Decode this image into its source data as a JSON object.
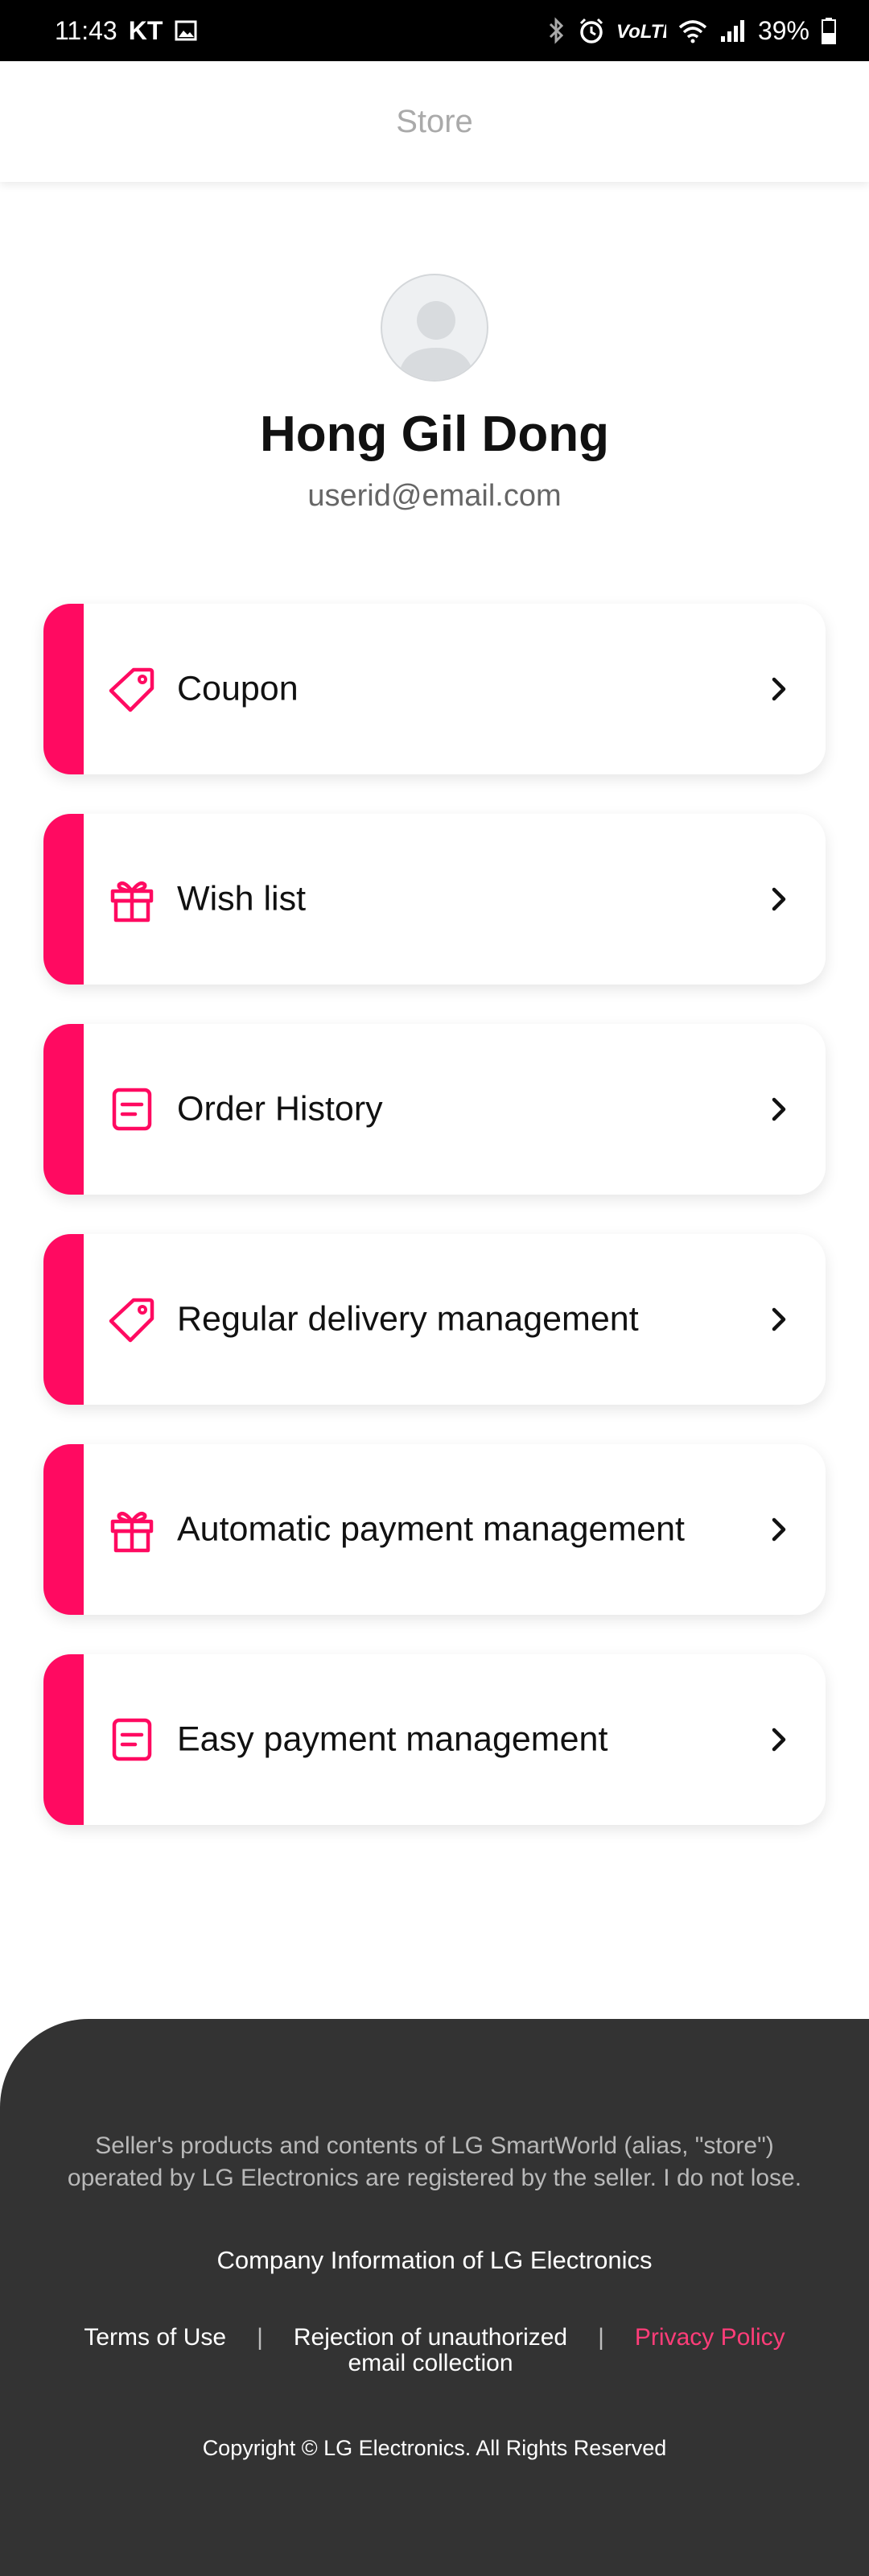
{
  "status_bar": {
    "time": "11:43",
    "carrier": "KT",
    "battery": "39%",
    "icons": [
      "image-icon",
      "bluetooth-icon",
      "alarm-icon",
      "volte-icon",
      "wifi-icon",
      "signal-icon",
      "battery-icon"
    ],
    "volte": "VoLTE"
  },
  "header": {
    "title": "Store"
  },
  "profile": {
    "name": "Hong Gil Dong",
    "email": "userid@email.com"
  },
  "menu": {
    "accent_color": "#ff0a61",
    "items": [
      {
        "label": "Coupon",
        "icon": "tag-icon"
      },
      {
        "label": "Wish list",
        "icon": "gift-icon"
      },
      {
        "label": "Order History",
        "icon": "document-icon"
      },
      {
        "label": "Regular delivery management",
        "icon": "tag-icon"
      },
      {
        "label": "Automatic payment management",
        "icon": "gift-icon"
      },
      {
        "label": "Easy payment management",
        "icon": "document-icon"
      }
    ]
  },
  "footer": {
    "notice_line1": "Seller's products and contents of LG SmartWorld (alias, \"store\")",
    "notice_line2": "operated by LG Electronics are registered by the seller. I do not lose.",
    "company_info": "Company Information of LG Electronics",
    "terms": "Terms of Use",
    "rejection_line1": "Rejection of unauthorized",
    "rejection_line2": "email collection",
    "separator": "|",
    "privacy": "Privacy Policy",
    "privacy_color": "#ff3d79",
    "copyright": "Copyright © LG Electronics. All Rights Reserved"
  }
}
